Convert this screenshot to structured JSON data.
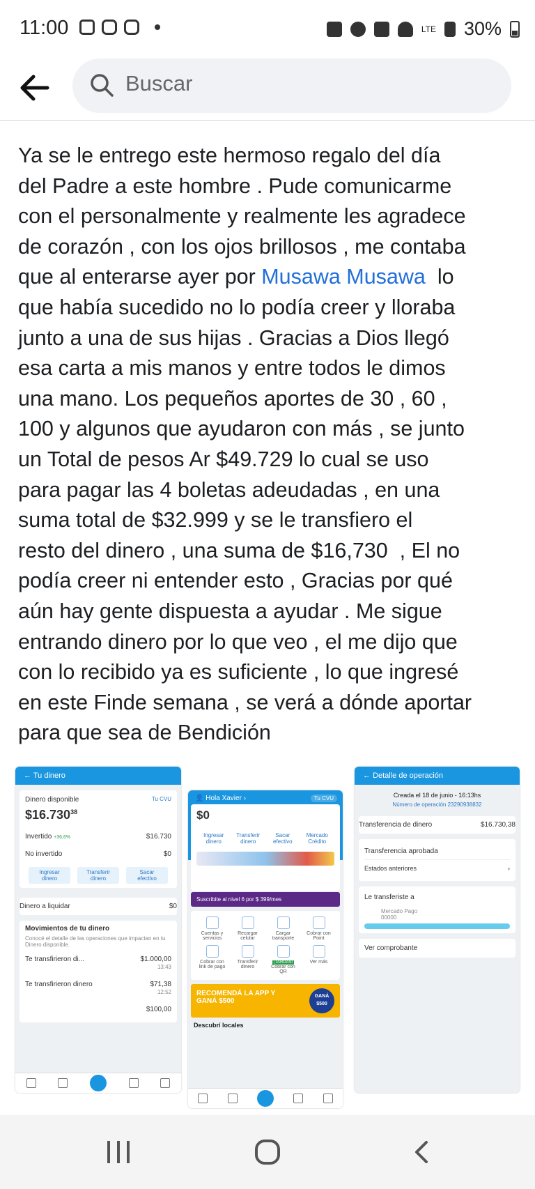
{
  "status_bar": {
    "time": "11:00",
    "battery": "30%",
    "network": "LTE"
  },
  "header": {
    "search_placeholder": "Buscar"
  },
  "post": {
    "text_before_mention": "Ya se le entrego este hermoso regalo del día\ndel Padre a este hombre . Pude comunicarme\ncon el personalmente y realmente les agradece\nde corazón , con los ojos brillosos , me contaba\nque al enterarse ayer por ",
    "mention": "Musawa Musawa",
    "text_after_mention": "  lo\nque había sucedido no lo podía creer y lloraba\njunto a una de sus hijas . Gracias a Dios llegó\nesa carta a mis manos y entre todos le dimos\nuna mano. Los pequeños aportes de 30 , 60 ,\n100 y algunos que ayudaron con más , se junto\nun Total de pesos Ar $49.729 lo cual se uso\npara pagar las 4 boletas adeudadas , en una\nsuma total de $32.999 y se le transfiero el\nresto del dinero , una suma de $16,730  , El no\npodía creer ni entender esto , Gracias por qué\naún hay gente dispuesta a ayudar . Me sigue\nentrando dinero por lo que veo , el me dijo que\ncon lo recibido ya es suficiente , lo que ingresé\nen este Finde semana , se verá a dónde aportar\npara que sea de Bendición"
  },
  "screens": {
    "left": {
      "title": "Tu dinero",
      "available_label": "Dinero disponible",
      "cvu": "Tu CVU",
      "available_amount": "$16.730",
      "available_cents": "38",
      "invested_label": "Invertido",
      "invested_rate": "36,6%",
      "invested_amount": "$16.730",
      "not_invested_label": "No invertido",
      "not_invested_amount": "$0",
      "actions": [
        "Ingresar dinero",
        "Transferir dinero",
        "Sacar efectivo"
      ],
      "to_settle_label": "Dinero a liquidar",
      "to_settle_amount": "$0",
      "movements_title": "Movimientos de tu dinero",
      "movements_sub": "Conocé el detalle de las operaciones que impactan en tu Dinero disponible.",
      "movements": [
        {
          "label": "Te transfirieron di...",
          "amount": "$1.000,00",
          "time": "13:43"
        },
        {
          "label": "Te transfirieron dinero",
          "amount": "$71,38",
          "time": "12:52"
        },
        {
          "label": "",
          "amount": "$100,00",
          "time": ""
        }
      ]
    },
    "middle": {
      "greeting": "Hola Xavier",
      "cvu": "Tu CVU",
      "balance": "$0",
      "actions": [
        "Ingresar dinero",
        "Transferir dinero",
        "Sacar efectivo",
        "Mercado Crédito"
      ],
      "promo": "Suscribite al nivel 6 por $ 399/mes",
      "grid": [
        "Cuentas y servicios",
        "Recargar celular",
        "Cargar transporte",
        "Cobrar con Point",
        "Cobrar con link de pago",
        "Transferir dinero",
        "Cobrar con QR",
        "Ver más"
      ],
      "new_badge": "¡TARDAS!",
      "banner_title": "RECOMENDÁ LA APP Y GANÁ $500",
      "banner_badge": "GANÁ $500",
      "discover": "Descubrí locales"
    },
    "right": {
      "title": "Detalle de operación",
      "created": "Creada el 18 de junio - 16:13hs",
      "operation_number": "Número de operación 23290938832",
      "transfer_label": "Transferencia de dinero",
      "transfer_amount": "$16.730,38",
      "approved": "Transferencia aprobada",
      "previous_states": "Estados anteriores",
      "transferred_to": "Le transferiste a",
      "recipient_sub": "Mercado Pago",
      "recipient_id": "00000",
      "view_receipt": "Ver comprobante"
    }
  },
  "colors": {
    "mention": "#216fdb",
    "mp_blue": "#1a96e0",
    "promo_purple": "#5b2a86",
    "promo_yellow": "#f7b500"
  }
}
